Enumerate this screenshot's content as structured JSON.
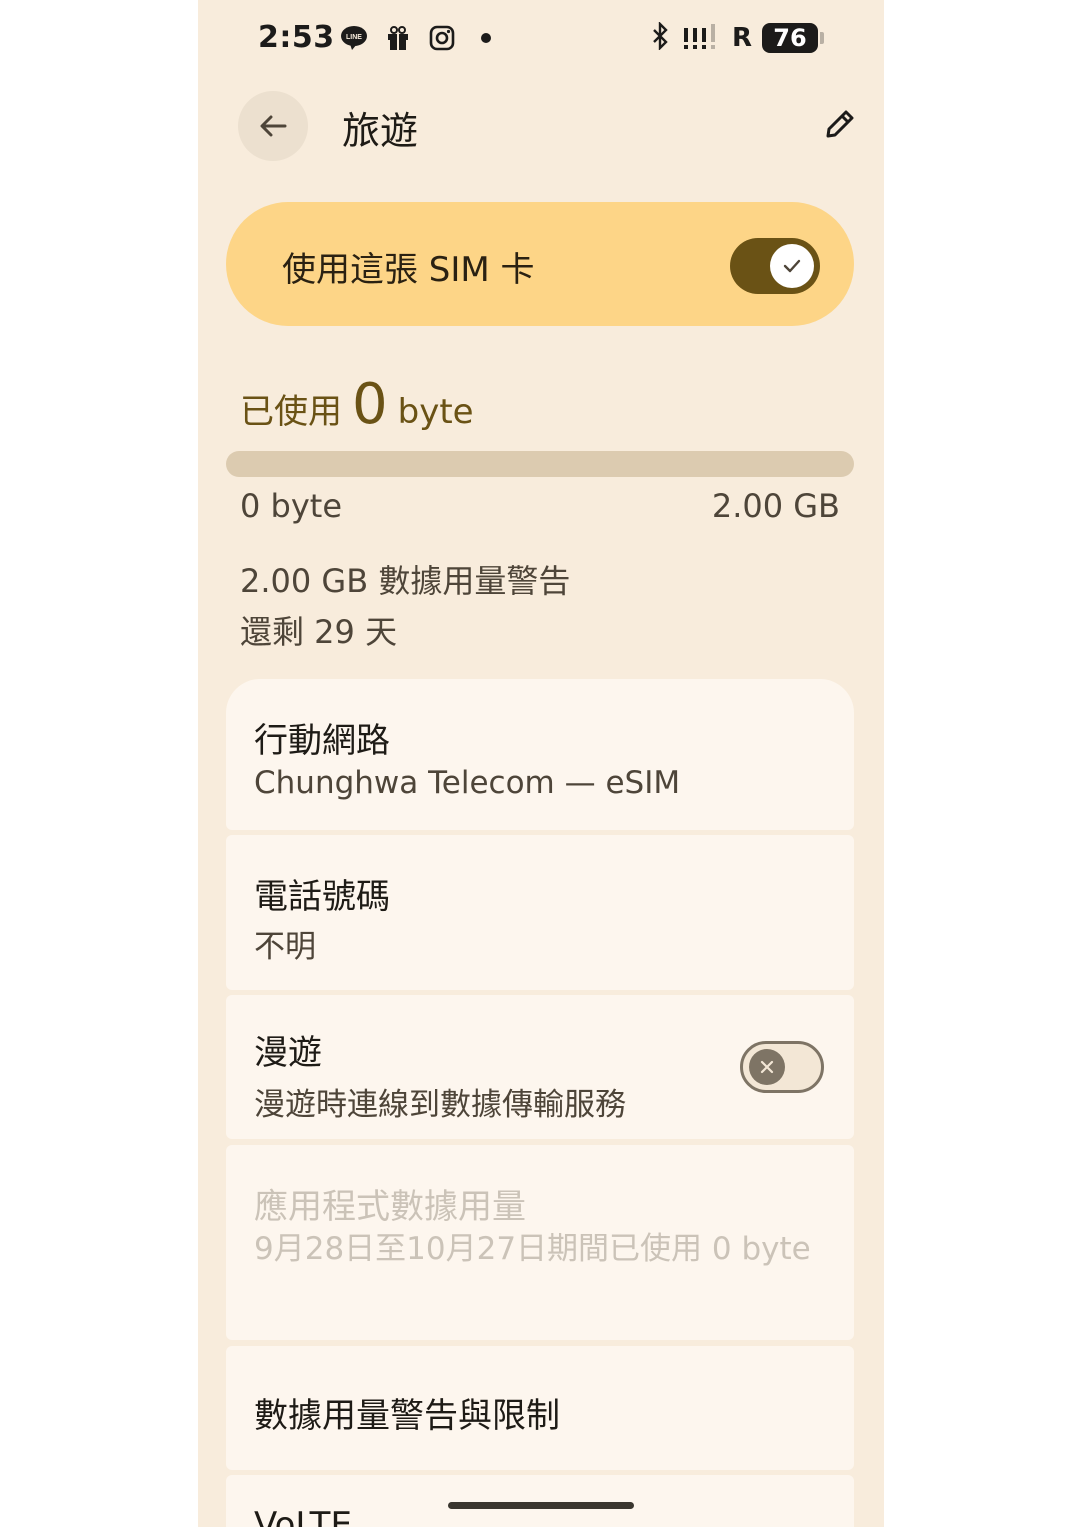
{
  "status_bar": {
    "time": "2:53",
    "line_badge": "LINE",
    "battery": "76"
  },
  "header": {
    "title": "旅遊"
  },
  "sim_toggle": {
    "label": "使用這張 SIM 卡",
    "on": true
  },
  "usage": {
    "prefix": "已使用",
    "amount": "0",
    "unit": "byte",
    "fraction_used": 0,
    "range_min": "0 byte",
    "range_max": "2.00 GB",
    "warning": "2.00 GB 數據用量警告",
    "days_left": "還剩 29 天"
  },
  "list": {
    "mobile_network": {
      "title": "行動網路",
      "subtitle": "Chunghwa Telecom — eSIM"
    },
    "phone_number": {
      "title": "電話號碼",
      "subtitle": "不明"
    },
    "roaming": {
      "title": "漫遊",
      "subtitle": "漫遊時連線到數據傳輸服務",
      "on": false
    },
    "app_data_usage": {
      "title": "應用程式數據用量",
      "subtitle": "9月28日至10月27日期間已使用 0 byte"
    },
    "data_warning_limit": {
      "title": "數據用量警告與限制"
    },
    "volte": {
      "title": "VoLTE"
    }
  },
  "colors": {
    "background": "#f8ecdc",
    "accent": "#6a5215",
    "toggle_card": "#fdd587",
    "card": "#fdf6ee"
  }
}
